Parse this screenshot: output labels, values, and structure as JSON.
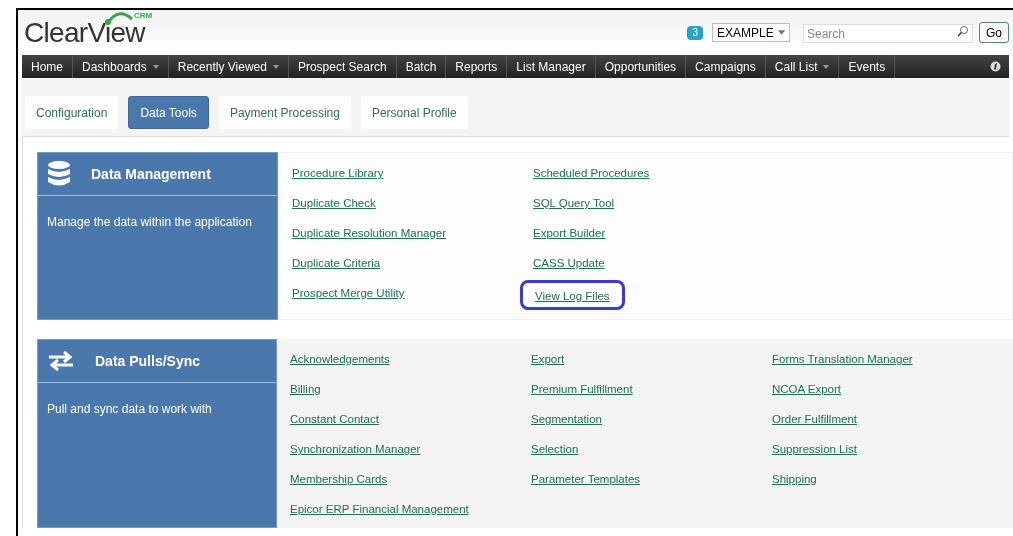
{
  "header": {
    "logo": "ClearView",
    "logo_badge": "CRM",
    "notification_count": "3",
    "database_select": "EXAMPLE",
    "search": {
      "placeholder": "Search"
    },
    "go_button": "Go"
  },
  "nav": [
    {
      "label": "Home",
      "has_menu": false
    },
    {
      "label": "Dashboards",
      "has_menu": true
    },
    {
      "label": "Recently Viewed",
      "has_menu": true
    },
    {
      "label": "Prospect Search",
      "has_menu": false
    },
    {
      "label": "Batch",
      "has_menu": false
    },
    {
      "label": "Reports",
      "has_menu": false
    },
    {
      "label": "List Manager",
      "has_menu": false
    },
    {
      "label": "Opportunities",
      "has_menu": false
    },
    {
      "label": "Campaigns",
      "has_menu": false
    },
    {
      "label": "Call List",
      "has_menu": true
    },
    {
      "label": "Events",
      "has_menu": false
    }
  ],
  "tabs": [
    {
      "label": "Configuration",
      "selected": false
    },
    {
      "label": "Data Tools",
      "selected": true
    },
    {
      "label": "Payment Processing",
      "selected": false
    },
    {
      "label": "Personal Profile",
      "selected": false
    }
  ],
  "sections": [
    {
      "title": "Data Management",
      "description": "Manage the data within the application",
      "columns": [
        [
          {
            "label": "Procedure Library",
            "highlighted": false
          },
          {
            "label": "Duplicate Check",
            "highlighted": false
          },
          {
            "label": "Duplicate Resolution Manager",
            "highlighted": false
          },
          {
            "label": "Duplicate Criteria",
            "highlighted": false
          },
          {
            "label": "Prospect Merge Utility",
            "highlighted": false
          }
        ],
        [
          {
            "label": "Scheduled Procedures",
            "highlighted": false
          },
          {
            "label": "SQL Query Tool",
            "highlighted": false
          },
          {
            "label": "Export Builder",
            "highlighted": false
          },
          {
            "label": "CASS Update",
            "highlighted": false
          },
          {
            "label": "View Log Files",
            "highlighted": true
          }
        ]
      ]
    },
    {
      "title": "Data Pulls/Sync",
      "description": "Pull and sync data to work with",
      "columns": [
        [
          {
            "label": "Acknowledgements",
            "highlighted": false
          },
          {
            "label": "Billing",
            "highlighted": false
          },
          {
            "label": "Constant Contact",
            "highlighted": false
          },
          {
            "label": "Synchronization Manager",
            "highlighted": false
          },
          {
            "label": "Membership Cards",
            "highlighted": false
          },
          {
            "label": "Epicor ERP Financial Management",
            "highlighted": false
          }
        ],
        [
          {
            "label": "Export",
            "highlighted": false
          },
          {
            "label": "Premium Fulfillment",
            "highlighted": false
          },
          {
            "label": "Segmentation",
            "highlighted": false
          },
          {
            "label": "Selection",
            "highlighted": false
          },
          {
            "label": "Parameter Templates",
            "highlighted": false
          }
        ],
        [
          {
            "label": "Forms Translation Manager",
            "highlighted": false
          },
          {
            "label": "NCOA Export",
            "highlighted": false
          },
          {
            "label": "Order Fulfillment",
            "highlighted": false
          },
          {
            "label": "Suppression List",
            "highlighted": false
          },
          {
            "label": "Shipping",
            "highlighted": false
          }
        ]
      ]
    }
  ]
}
